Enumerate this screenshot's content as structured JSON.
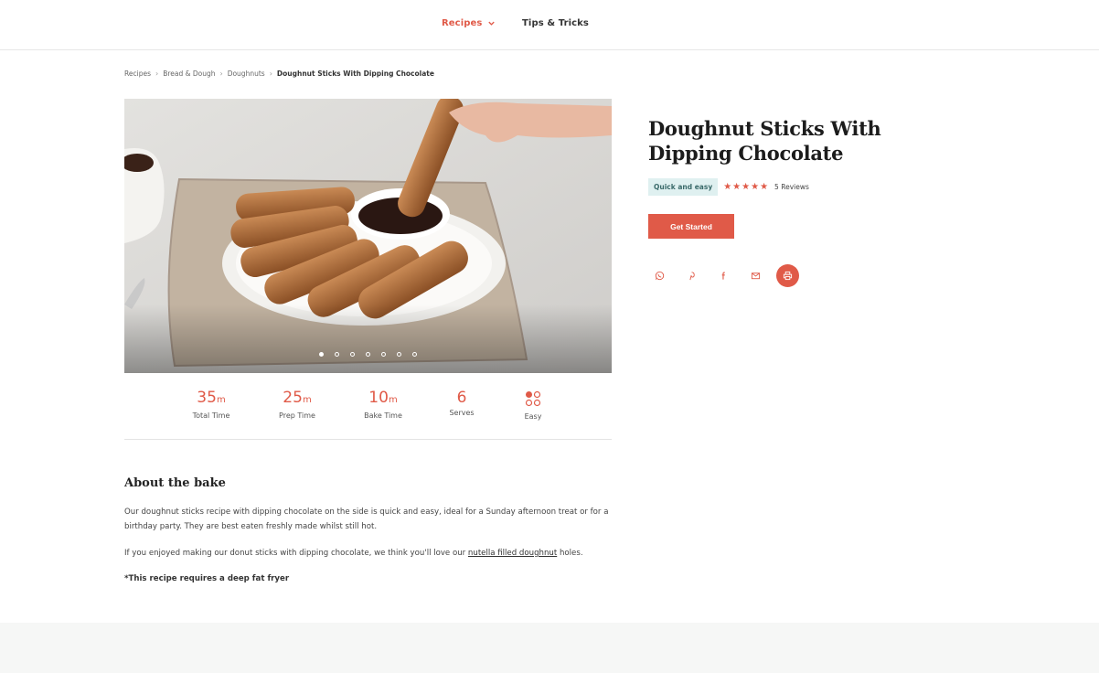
{
  "nav": {
    "recipes_label": "Recipes",
    "tips_label": "Tips & Tricks"
  },
  "breadcrumb": [
    "Recipes",
    "Bread & Dough",
    "Doughnuts",
    "Doughnut Sticks With Dipping Chocolate"
  ],
  "breadcrumb_separator": "›",
  "gallery": {
    "slide_count": 7,
    "active_slide": 1
  },
  "stats": [
    {
      "value": "35",
      "unit": "m",
      "label": "Total Time"
    },
    {
      "value": "25",
      "unit": "m",
      "label": "Prep Time"
    },
    {
      "value": "10",
      "unit": "m",
      "label": "Bake Time"
    },
    {
      "value": "6",
      "unit": "",
      "label": "Serves"
    },
    {
      "value": "",
      "unit": "",
      "label": "Easy",
      "icon": "difficulty-icon"
    }
  ],
  "about": {
    "title": "About the bake",
    "p1": "Our doughnut sticks recipe with dipping chocolate on the side is quick and easy, ideal for a Sunday afternoon treat or for a birthday party. They are best eaten freshly made whilst still hot.",
    "p2_before": "If you enjoyed making our donut sticks with dipping chocolate, we think you'll love our ",
    "p2_link": "nutella filled doughnut",
    "p2_after": " holes.",
    "note": "*This recipe requires a deep fat fryer"
  },
  "recipe": {
    "title": "Doughnut Sticks With Dipping Chocolate",
    "tag": "Quick and easy",
    "stars": "★★★★★",
    "rating": 5,
    "reviews": "5 Reviews",
    "cta": "Get Started"
  },
  "share_icons": [
    "whatsapp-icon",
    "pinterest-icon",
    "facebook-icon",
    "email-icon",
    "print-icon"
  ],
  "colors": {
    "accent": "#e05a48",
    "tag_bg": "#dff0f0",
    "footer_bg": "#f6f7f6"
  }
}
